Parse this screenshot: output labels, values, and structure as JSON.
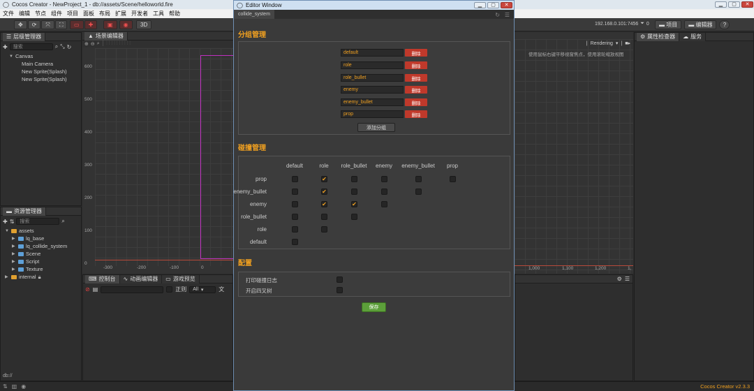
{
  "main_window": {
    "title": "Cocos Creator - NewProject_1 - db://assets/Scene/helloworld.fire",
    "menu": [
      "文件",
      "编辑",
      "节点",
      "组件",
      "项目",
      "面板",
      "布局",
      "扩展",
      "开发者",
      "工具",
      "帮助"
    ]
  },
  "toolbar": {
    "three_d": "3D",
    "ip_text": "192.168.0.101:7456",
    "wifi_count": "0",
    "project_btn": "项目",
    "editor_btn": "编辑器",
    "help": "?"
  },
  "hierarchy": {
    "title": "层级管理器",
    "search_placeholder": "搜索",
    "nodes": [
      "Canvas",
      "Main Camera",
      "New Sprite(Splash)",
      "New Sprite(Splash)"
    ]
  },
  "assets": {
    "title": "资源管理器",
    "search_placeholder": "搜索",
    "items": [
      "assets",
      "lq_base",
      "lq_collide_system",
      "Scene",
      "Script",
      "Texture",
      "internal"
    ],
    "path": "db://"
  },
  "scene": {
    "title": "场景编辑器",
    "y_ticks": [
      "600",
      "500",
      "400",
      "300",
      "200",
      "100",
      "0"
    ],
    "x_ticks": [
      "-300",
      "-200",
      "-100",
      "0"
    ],
    "right_x_ticks": [
      "1,000",
      "1,100",
      "1,200",
      "1,"
    ],
    "rendering": "Rendering",
    "hint": "使用鼠标右键平移视窗焦点，使用滚轮缩放视图"
  },
  "console": {
    "tabs": [
      "控制台",
      "动画编辑器",
      "游戏预览"
    ],
    "regex": "正则",
    "filter": "All"
  },
  "inspector": {
    "tabs": [
      "属性检查器",
      "服务"
    ]
  },
  "version": "Cocos Creator v2.3.3",
  "editor_window": {
    "title": "Editor Window",
    "tab": "collide_system",
    "group_section": "分组管理",
    "groups": [
      "default",
      "role",
      "role_bullet",
      "enemy",
      "enemy_bullet",
      "prop"
    ],
    "delete_label": "删除",
    "add_group": "添加分组",
    "collision_section": "碰撞管理",
    "col_headers": [
      "default",
      "role",
      "role_bullet",
      "enemy",
      "enemy_bullet",
      "prop"
    ],
    "row_headers": [
      "prop",
      "enemy_bullet",
      "enemy",
      "role_bullet",
      "role",
      "default"
    ],
    "matrix": [
      [
        false,
        true,
        false,
        false,
        false,
        false
      ],
      [
        false,
        true,
        false,
        false,
        false
      ],
      [
        false,
        true,
        true,
        false
      ],
      [
        false,
        false,
        false
      ],
      [
        false,
        false
      ],
      [
        false
      ]
    ],
    "config_section": "配置",
    "config_items": [
      {
        "label": "打印碰撞日志",
        "checked": false
      },
      {
        "label": "开启四叉树",
        "checked": false
      }
    ],
    "save": "保存"
  },
  "colors": {
    "accent": "#f0a020",
    "delete": "#c0392b",
    "save": "#5c9f3a"
  }
}
